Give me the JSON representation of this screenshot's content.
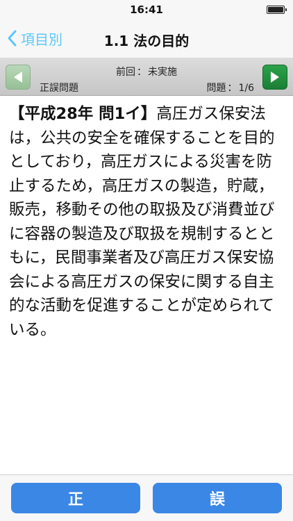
{
  "status_bar": {
    "time": "16:41"
  },
  "nav": {
    "back_label": "項目別",
    "title": "1.1 法の目的"
  },
  "question_bar": {
    "prev_icon": "play-left-icon",
    "next_icon": "play-right-icon",
    "question_type": "正誤問題",
    "last_result_label": "前回",
    "last_result_value": "未実施",
    "question_label": "問題",
    "question_position": "1/6"
  },
  "question": {
    "tag": "【平成28年 問1イ】",
    "text": "高圧ガス保安法は，公共の安全を確保することを目的としており，高圧ガスによる災害を防止するため，高圧ガスの製造，貯蔵，販売，移動その他の取扱及び消費並びに容器の製造及び取扱を規制するとともに，民間事業者及び高圧ガス保安協会による高圧ガスの保安に関する自主的な活動を促進することが定められている。"
  },
  "answers": {
    "true_label": "正",
    "false_label": "誤"
  },
  "colors": {
    "accent_blue": "#5ac8fa",
    "answer_button": "#3a87e6",
    "next_button_green": "#1f8f3d",
    "prev_button_green_disabled": "#a8cfa8"
  }
}
